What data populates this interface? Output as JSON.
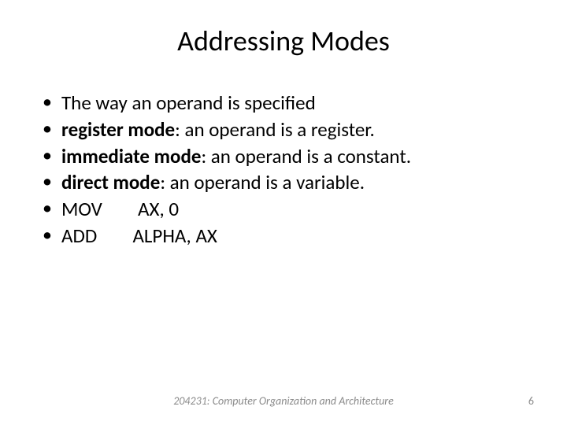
{
  "slide": {
    "title": "Addressing Modes",
    "bullets": [
      {
        "bold": "",
        "rest": "The way an operand is specified"
      },
      {
        "bold": "register mode",
        "rest": ": an operand is a register."
      },
      {
        "bold": "immediate mode",
        "rest": ": an operand is a constant."
      },
      {
        "bold": "direct mode",
        "rest": ": an operand is a variable."
      },
      {
        "bold": "",
        "rest": "MOV        AX, 0"
      },
      {
        "bold": "",
        "rest": "ADD        ALPHA, AX"
      }
    ],
    "footer": "204231: Computer Organization and Architecture",
    "page_number": "6"
  }
}
